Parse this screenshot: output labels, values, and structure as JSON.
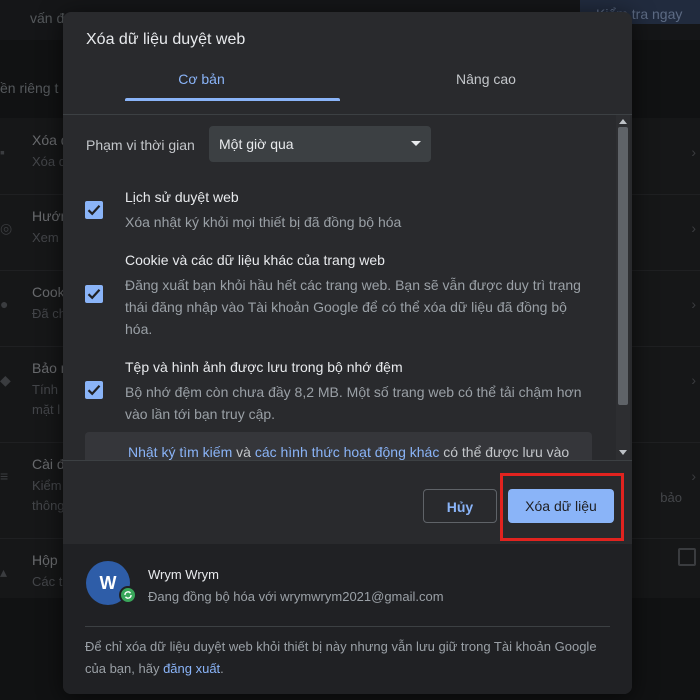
{
  "background": {
    "top_text": "vấn đ",
    "top_button": "Kiểm tra ngay",
    "section_label": "ền riêng t",
    "rows": [
      {
        "title": "Xóa d",
        "desc": "Xóa d"
      },
      {
        "title": "Hướn",
        "desc": "Xem"
      },
      {
        "title": "Cook",
        "desc": "Đã ch"
      },
      {
        "title": "Bảo m",
        "desc": "Tính"
      },
      {
        "title": "Cài đ",
        "desc": "Kiểm"
      },
      {
        "title": "Hộp",
        "desc": "Các t"
      }
    ],
    "extra_text": "bảo",
    "extra_row_text_a": "mặt l",
    "extra_row_text_b": "thông"
  },
  "dialog": {
    "title": "Xóa dữ liệu duyệt web",
    "tabs": [
      {
        "label": "Cơ bản",
        "active": true
      },
      {
        "label": "Nâng cao",
        "active": false
      }
    ],
    "time_range": {
      "label": "Phạm vi thời gian",
      "value": "Một giờ qua"
    },
    "options": [
      {
        "title": "Lịch sử duyệt web",
        "desc": "Xóa nhật ký khỏi mọi thiết bị đã đồng bộ hóa",
        "checked": true
      },
      {
        "title": "Cookie và các dữ liệu khác của trang web",
        "desc": "Đăng xuất bạn khỏi hầu hết các trang web. Bạn sẽ vẫn được duy trì trạng thái đăng nhập vào Tài khoản Google để có thể xóa dữ liệu đã đồng bộ hóa.",
        "checked": true
      },
      {
        "title": "Tệp và hình ảnh được lưu trong bộ nhớ đệm",
        "desc": "Bộ nhớ đệm còn chưa đầy 8,2 MB. Một số trang web có thể tải chậm hơn vào lần tới bạn truy cập.",
        "checked": true
      }
    ],
    "info": {
      "link1": "Nhật ký tìm kiếm",
      "middle": " và ",
      "link2": "các hình thức hoạt động khác",
      "tail": " có thể được lưu vào"
    },
    "buttons": {
      "cancel": "Hủy",
      "clear": "Xóa dữ liệu"
    },
    "account": {
      "initial": "W",
      "name": "Wrym Wrym",
      "email": "Đang đồng bộ hóa với wrymwrym2021@gmail.com"
    },
    "note": {
      "text": "Để chỉ xóa dữ liệu duyệt web khỏi thiết bị này nhưng vẫn lưu giữ trong Tài khoản Google của bạn, hãy ",
      "link": "đăng xuất",
      "end": "."
    }
  },
  "colors": {
    "accent": "#8ab4f8",
    "highlight": "#e1231f",
    "dialog_bg": "#292a2d",
    "sync_green": "#39a65a"
  }
}
